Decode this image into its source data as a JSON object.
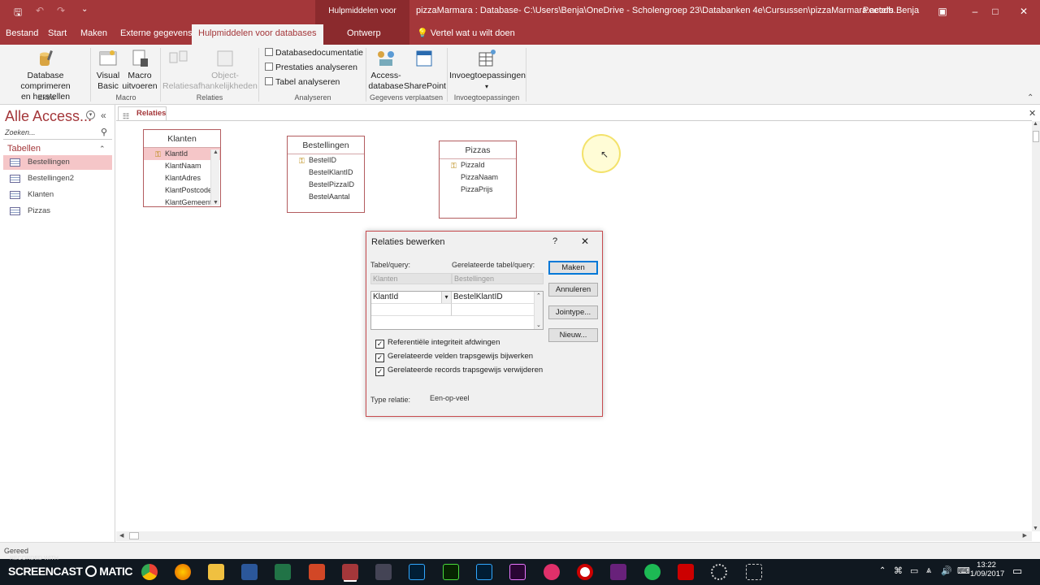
{
  "titlebar": {
    "context_group": "Hulpmiddelen voor relaties",
    "title": "pizzaMarmara : Database- C:\\Users\\Benja\\OneDrive - Scholengroep 23\\Databanken 4e\\Cursussen\\pizzaMarmara.accdb...",
    "user": "Peeters Benja"
  },
  "tabs": [
    "Bestand",
    "Start",
    "Maken",
    "Externe gegevens",
    "Hulpmiddelen voor databases",
    "Ontwerp"
  ],
  "tell_me": "Vertel wat u wilt doen",
  "ribbon": {
    "compact_line1": "Database comprimeren",
    "compact_line2": "en herstellen",
    "group_extra": "Extra",
    "visual_basic_line1": "Visual",
    "visual_basic_line2": "Basic",
    "macro_line1": "Macro",
    "macro_line2": "uitvoeren",
    "group_macro": "Macro",
    "relaties": "Relaties",
    "object_dep_line1": "Object-",
    "object_dep_line2": "afhankelijkheden",
    "group_relaties": "Relaties",
    "db_doc": "Databasedocumentatie",
    "perf": "Prestaties analyseren",
    "tabel": "Tabel analyseren",
    "group_analyseren": "Analyseren",
    "access_db_line1": "Access-",
    "access_db_line2": "database",
    "sharepoint": "SharePoint",
    "group_verplaatsen": "Gegevens verplaatsen",
    "addins": "Invoegtoepassingen",
    "group_addins": "Invoegtoepassingen"
  },
  "nav": {
    "header": "Alle Access...",
    "search_placeholder": "Zoeken...",
    "section": "Tabellen",
    "items": [
      "Bestellingen",
      "Bestellingen2",
      "Klanten",
      "Pizzas"
    ]
  },
  "doc_tab": "Relaties",
  "tables": {
    "klanten": {
      "title": "Klanten",
      "fields": [
        "KlantId",
        "KlantNaam",
        "KlantAdres",
        "KlantPostcode",
        "KlantGemeente"
      ]
    },
    "bestellingen": {
      "title": "Bestellingen",
      "fields": [
        "BestelID",
        "BestelKlantID",
        "BestelPizzaID",
        "BestelAantal"
      ]
    },
    "pizzas": {
      "title": "Pizzas",
      "fields": [
        "PizzaId",
        "PizzaNaam",
        "PizzaPrijs"
      ]
    }
  },
  "dialog": {
    "title": "Relaties bewerken",
    "help": "?",
    "label_table": "Tabel/query:",
    "label_related": "Gerelateerde tabel/query:",
    "table_value": "Klanten",
    "related_value": "Bestellingen",
    "field_left": "KlantId",
    "field_right": "BestelKlantID",
    "btn_create": "Maken",
    "btn_cancel": "Annuleren",
    "btn_join": "Jointype...",
    "btn_new": "Nieuw...",
    "check1": "Referentiële integriteit afdwingen",
    "check2": "Gerelateerde velden trapsgewijs bijwerken",
    "check3": "Gerelateerde records trapsgewijs verwijderen",
    "type_label": "Type relatie:",
    "type_value": "Een-op-veel"
  },
  "status": "Gereed",
  "taskbar": {
    "watermark_top": "RECORDED WITH",
    "watermark": "SCREENCAST",
    "watermark2": "MATIC",
    "time": "13:22",
    "date": "1/09/2017"
  },
  "colors": {
    "accent": "#a4373a",
    "selection": "#f5c6c8"
  }
}
